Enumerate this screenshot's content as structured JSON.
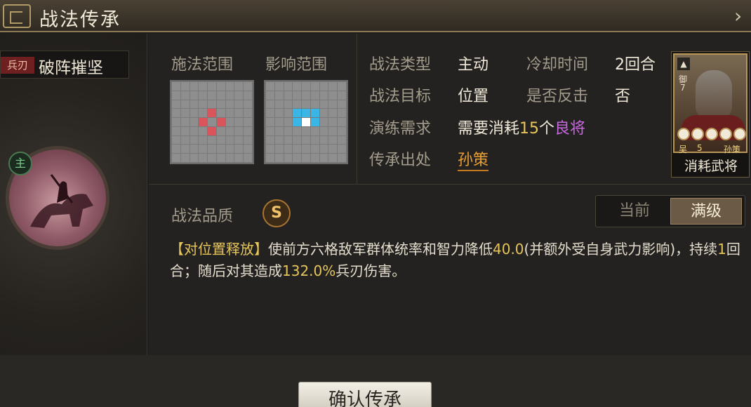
{
  "window": {
    "title": "战法传承"
  },
  "skill": {
    "type_tag": "兵刃",
    "name": "破阵摧坚",
    "main_badge": "主"
  },
  "range": {
    "cast_label": "施法范围",
    "effect_label": "影响范围",
    "cast_cells": [
      [
        3,
        4
      ],
      [
        4,
        3
      ],
      [
        4,
        5
      ],
      [
        5,
        4
      ]
    ],
    "effect_blue_cells": [
      [
        3,
        3
      ],
      [
        3,
        4
      ],
      [
        3,
        5
      ],
      [
        4,
        3
      ],
      [
        4,
        5
      ]
    ],
    "effect_white_cells": [
      [
        4,
        4
      ]
    ]
  },
  "info": {
    "type_label": "战法类型",
    "type_value": "主动",
    "cd_label": "冷却时间",
    "cd_value": "2回合",
    "target_label": "战法目标",
    "target_value": "位置",
    "counter_label": "是否反击",
    "counter_value": "否",
    "train_label": "演练需求",
    "train_prefix": "需要消耗",
    "train_count": "15",
    "train_unit": "个",
    "train_item": "良将",
    "origin_label": "传承出处",
    "origin_value": "孙策"
  },
  "card": {
    "faction": "吴",
    "level": "5",
    "name": "孙策",
    "def_tag": "御",
    "def_level": "7",
    "label": "消耗武将",
    "stars": 5
  },
  "quality": {
    "label": "战法品质",
    "grade": "S"
  },
  "toggle": {
    "current": "当前",
    "max": "满级",
    "selected": "max"
  },
  "description": {
    "tag": "【对位置释放】",
    "part1": "使前方六格敌军群体统率和智力降低",
    "num1": "40.0",
    "part2": "(并额外受自身武力影响)，持续",
    "num2": "1",
    "part3": "回合；随后对其造成",
    "num3": "132.0%",
    "part4": "兵刃伤害。"
  },
  "buttons": {
    "confirm": "确认传承"
  },
  "colors": {
    "accent_gold": "#e9c75b",
    "accent_purple": "#c768e0",
    "accent_orange": "#e8a035",
    "red_cell": "#d9545b",
    "blue_cell": "#39b6e6"
  }
}
